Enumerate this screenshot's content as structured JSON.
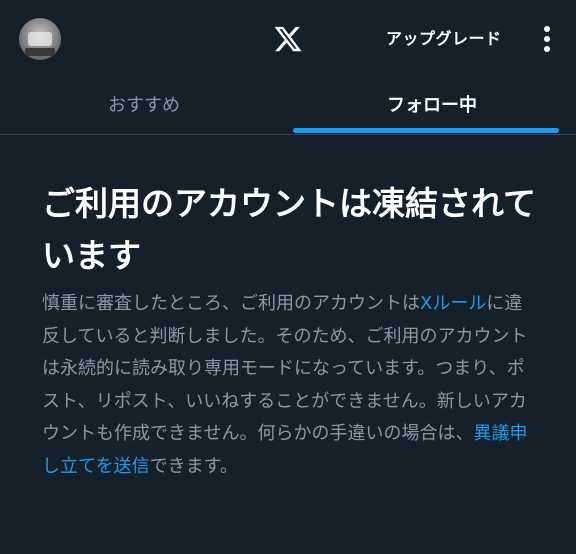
{
  "header": {
    "logo_icon": "x-logo-icon",
    "upgrade_label": "アップグレード",
    "more_icon": "more-vertical-icon"
  },
  "tabs": [
    {
      "label": "おすすめ",
      "active": false
    },
    {
      "label": "フォロー中",
      "active": true
    }
  ],
  "notice": {
    "title": "ご利用のアカウントは凍結されています",
    "body_part1": "慎重に審査したところ、ご利用のアカウントは",
    "rules_link": "Xルール",
    "body_part2": "に違反していると判断しました。そのため、ご利用のアカウントは永続的に読み取り専用モードになっています。つまり、ポスト、リポスト、いいねすることができません。新しいアカウントも作成できません。何らかの手違いの場合は、",
    "appeal_link": "異議申し立てを送信",
    "body_part3": "できます。"
  },
  "colors": {
    "background": "#15202b",
    "accent": "#1d9bf0",
    "muted_text": "#8b98a5",
    "divider": "#38444d"
  }
}
